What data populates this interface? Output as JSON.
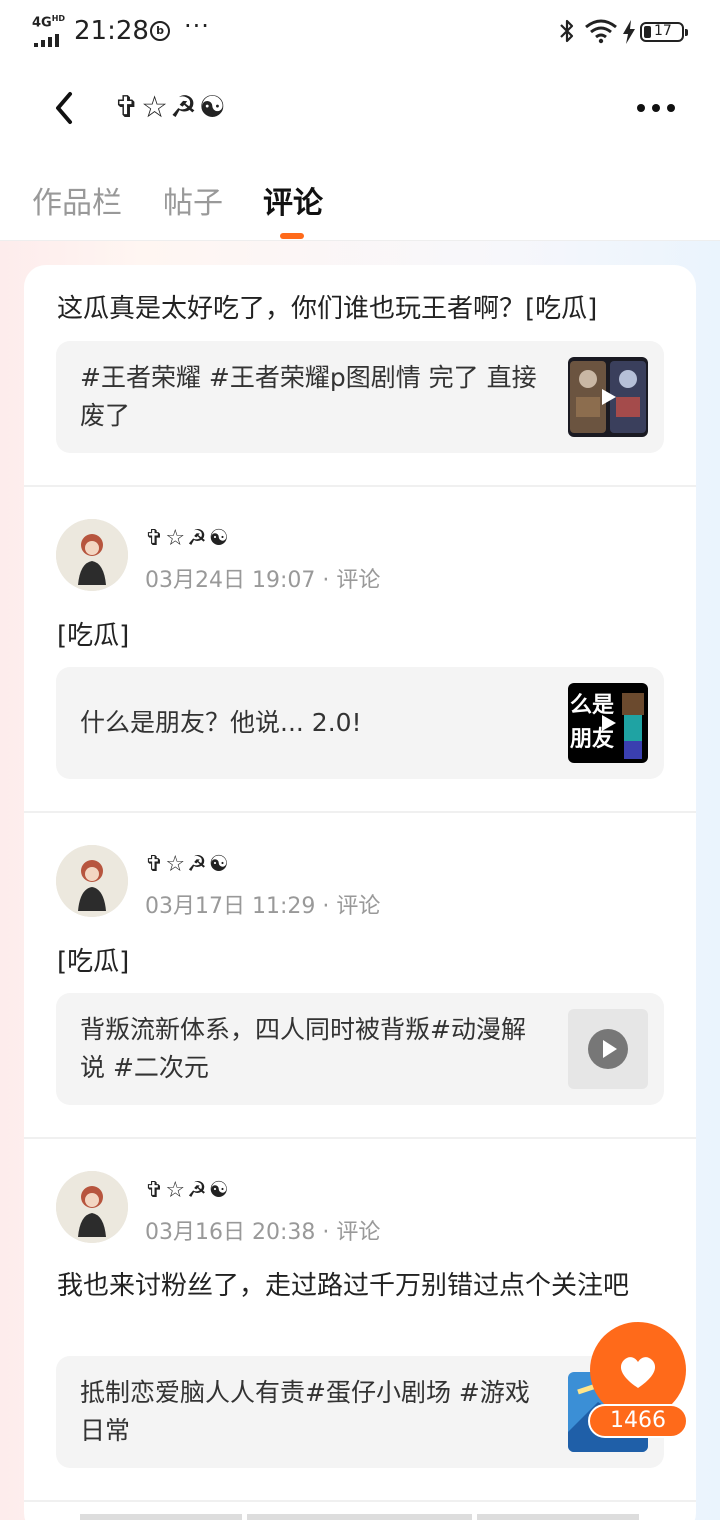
{
  "status_bar": {
    "network": "4G",
    "network_sup": "HD",
    "time": "21:28",
    "more": "···",
    "battery": "17"
  },
  "header": {
    "title": "✞☆☭☯"
  },
  "tabs": [
    {
      "label": "作品栏",
      "active": false
    },
    {
      "label": "帖子",
      "active": false
    },
    {
      "label": "评论",
      "active": true
    }
  ],
  "feed": {
    "top": {
      "text": "这瓜真是太好吃了，你们谁也玩王者啊？[吃瓜]",
      "quote": "#王者荣耀 #王者荣耀p图剧情 完了 直接废了"
    },
    "comments": [
      {
        "user": "✞☆☭☯",
        "time": "03月24日 19:07",
        "action": "评论",
        "text": "[吃瓜]",
        "quote": "什么是朋友？他说... 2.0!",
        "thumb_text": "么是朋友"
      },
      {
        "user": "✞☆☭☯",
        "time": "03月17日 11:29",
        "action": "评论",
        "text": "[吃瓜]",
        "quote": "背叛流新体系，四人同时被背叛#动漫解说 #二次元"
      },
      {
        "user": "✞☆☭☯",
        "time": "03月16日 20:38",
        "action": "评论",
        "text": "我也来讨粉丝了，走过路过千万别错过点个关注吧",
        "quote": "抵制恋爱脑人人有责#蛋仔小剧场 #游戏日常"
      }
    ]
  },
  "like": {
    "count": "1466"
  },
  "colors": {
    "accent": "#ff6a1a"
  }
}
